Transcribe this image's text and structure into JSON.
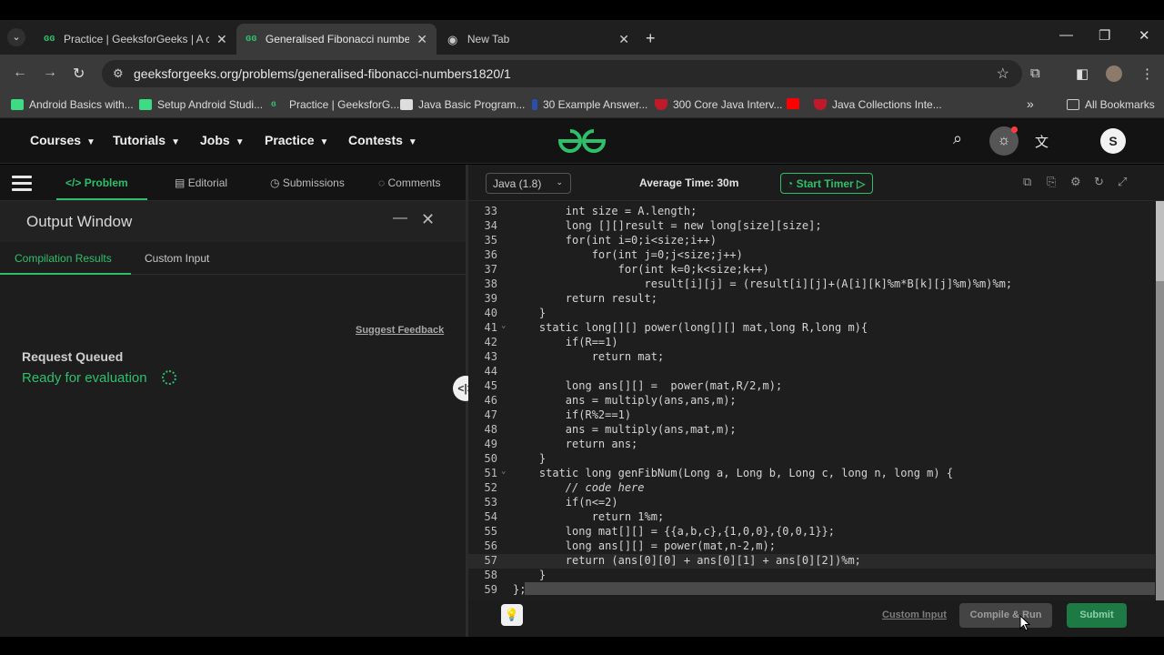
{
  "browser": {
    "tabs": [
      {
        "title": "Practice | GeeksforGeeks | A co",
        "active": false
      },
      {
        "title": "Generalised Fibonacci numbers",
        "active": true
      },
      {
        "title": "New Tab",
        "active": false
      }
    ],
    "url": "geeksforgeeks.org/problems/generalised-fibonacci-numbers1820/1",
    "bookmarks": [
      "Android Basics with...",
      "Setup Android Studi...",
      "Practice | GeeksforG...",
      "Java Basic Program...",
      "30 Example Answer...",
      "300 Core Java Interv...",
      "Java Collections Inte..."
    ],
    "all_bookmarks": "All Bookmarks",
    "overflow": "»"
  },
  "site": {
    "nav": [
      "Courses",
      "Tutorials",
      "Jobs",
      "Practice",
      "Contests"
    ],
    "logo": "GG",
    "avatar_letter": "S",
    "brand_color": "#2fbf6b"
  },
  "problem_tabs": [
    "Problem",
    "Editorial",
    "Submissions",
    "Comments"
  ],
  "output": {
    "title": "Output Window",
    "tabs": [
      "Compilation Results",
      "Custom Input"
    ],
    "suggest": "Suggest Feedback",
    "status": "Request Queued",
    "ready": "Ready for evaluation"
  },
  "editor": {
    "language": "Java (1.8)",
    "avg_time": "Average Time: 30m",
    "timer": "Start Timer",
    "lines": [
      {
        "n": "33",
        "code": "        int size = A.length;"
      },
      {
        "n": "34",
        "code": "        long [][]result = new long[size][size];"
      },
      {
        "n": "35",
        "code": "        for(int i=0;i<size;i++)"
      },
      {
        "n": "36",
        "code": "            for(int j=0;j<size;j++)"
      },
      {
        "n": "37",
        "code": "                for(int k=0;k<size;k++)"
      },
      {
        "n": "38",
        "code": "                    result[i][j] = (result[i][j]+(A[i][k]%m*B[k][j]%m)%m)%m;"
      },
      {
        "n": "39",
        "code": "        return result;"
      },
      {
        "n": "40",
        "code": "    }"
      },
      {
        "n": "41",
        "code": "    static long[][] power(long[][] mat,long R,long m){"
      },
      {
        "n": "42",
        "code": "        if(R==1)"
      },
      {
        "n": "43",
        "code": "            return mat;"
      },
      {
        "n": "44",
        "code": ""
      },
      {
        "n": "45",
        "code": "        long ans[][] =  power(mat,R/2,m);"
      },
      {
        "n": "46",
        "code": "        ans = multiply(ans,ans,m);"
      },
      {
        "n": "47",
        "code": "        if(R%2==1)"
      },
      {
        "n": "48",
        "code": "        ans = multiply(ans,mat,m);"
      },
      {
        "n": "49",
        "code": "        return ans;"
      },
      {
        "n": "50",
        "code": "    }"
      },
      {
        "n": "51",
        "code": "    static long genFibNum(Long a, Long b, Long c, long n, long m) {"
      },
      {
        "n": "52",
        "code": "        // code here"
      },
      {
        "n": "53",
        "code": "        if(n<=2)"
      },
      {
        "n": "54",
        "code": "            return 1%m;"
      },
      {
        "n": "55",
        "code": "        long mat[][] = {{a,b,c},{1,0,0},{0,0,1}};"
      },
      {
        "n": "56",
        "code": "        long ans[][] = power(mat,n-2,m);"
      },
      {
        "n": "57",
        "code": "        return (ans[0][0] + ans[0][1] + ans[0][2])%m;"
      },
      {
        "n": "58",
        "code": "    }"
      },
      {
        "n": "59",
        "code": "};"
      }
    ]
  },
  "actions": {
    "custom_input": "Custom Input",
    "compile": "Compile & Run",
    "submit": "Submit"
  }
}
